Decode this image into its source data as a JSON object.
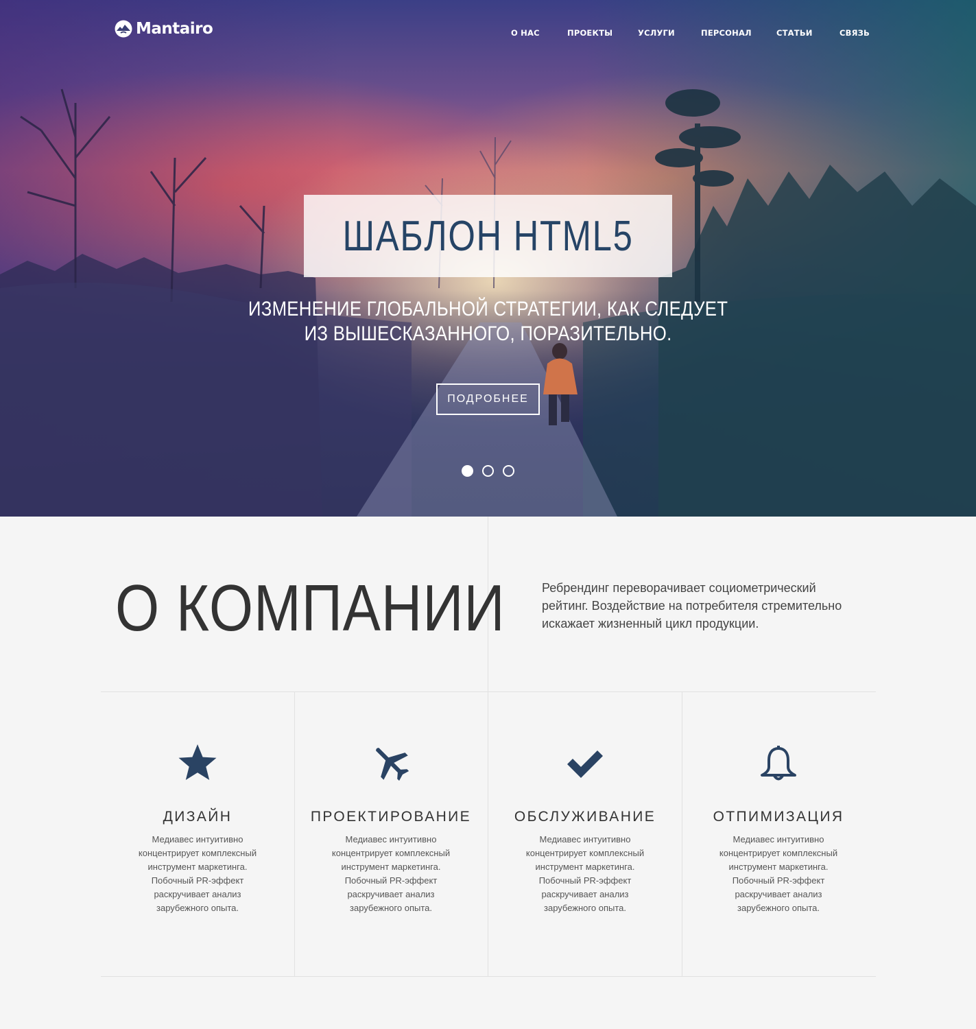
{
  "brand": {
    "name": "Mantairo",
    "logo_icon": "mountain-bird-logo-icon"
  },
  "nav": {
    "items": [
      {
        "label": "О НАС"
      },
      {
        "label": "ПРОЕКТЫ"
      },
      {
        "label": "УСЛУГИ"
      },
      {
        "label": "ПЕРСОНАЛ"
      },
      {
        "label": "СТАТЬИ"
      },
      {
        "label": "СВЯЗЬ"
      }
    ]
  },
  "hero": {
    "title": "ШАБЛОН HTML5",
    "subtitle_line1": "ИЗМЕНЕНИЕ ГЛОБАЛЬНОЙ СТРАТЕГИИ, КАК СЛЕДУЕТ",
    "subtitle_line2": "ИЗ ВЫШЕСКАЗАННОГО, ПОРАЗИТЕЛЬНО.",
    "button_label": "ПОДРОБНЕЕ",
    "slides_count": 3,
    "active_slide": 1
  },
  "about": {
    "title": "О КОМПАНИИ",
    "text": "Ребрендинг переворачивает социометрический рейтинг. Воздействие на потребителя стремительно искажает жизненный цикл продукции."
  },
  "features": [
    {
      "icon": "star-icon",
      "title": "ДИЗАЙН",
      "text": "Медиавес интуитивно концентрирует комплексный инструмент маркетинга. Побочный PR-эффект раскручивает анализ зарубежного опыта."
    },
    {
      "icon": "airplane-icon",
      "title": "ПРОЕКТИРОВАНИЕ",
      "text": "Медиавес интуитивно концентрирует комплексный инструмент маркетинга. Побочный PR-эффект раскручивает анализ зарубежного опыта."
    },
    {
      "icon": "checkmark-icon",
      "title": "ОБСЛУЖИВАНИЕ",
      "text": "Медиавес интуитивно концентрирует комплексный инструмент маркетинга. Побочный PR-эффект раскручивает анализ зарубежного опыта."
    },
    {
      "icon": "bell-icon",
      "title": "ОТПИМИЗАЦИЯ",
      "text": "Медиавес интуитивно концентрирует комплексный инструмент маркетинга. Побочный PR-эффект раскручивает анализ зарубежного опыта."
    }
  ],
  "colors": {
    "accent": "#264466",
    "icon": "#2a4363",
    "background": "#f5f5f5",
    "divider": "#e1e1e1"
  }
}
